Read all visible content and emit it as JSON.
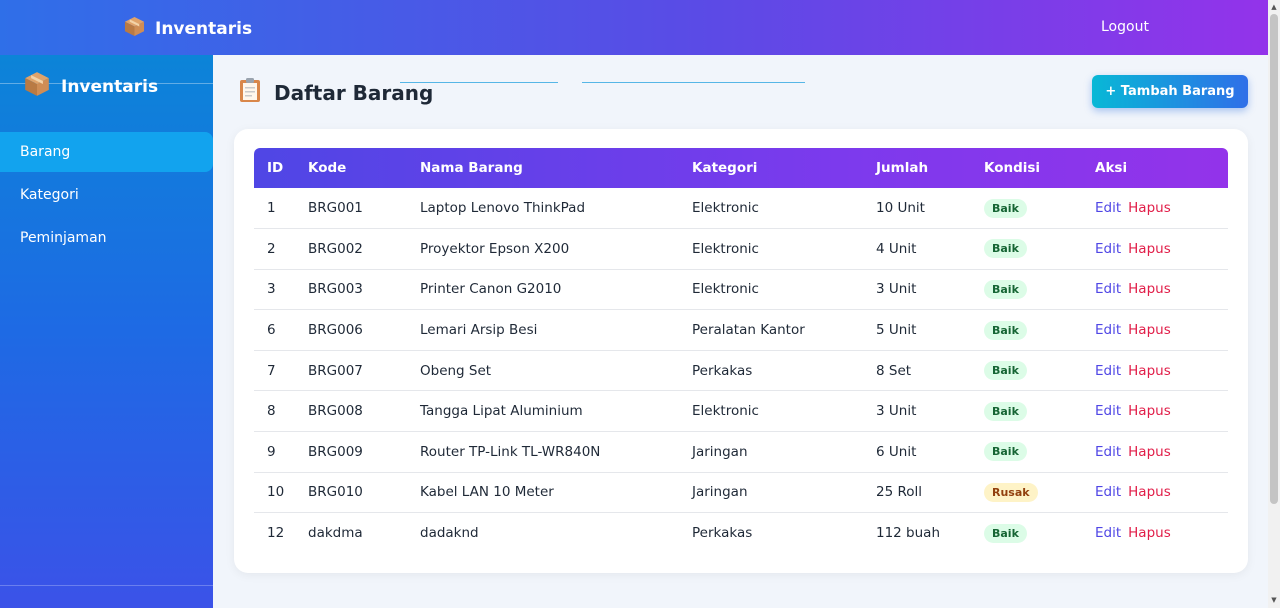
{
  "topbar": {
    "brand": "Inventaris",
    "brand_icon": "box-icon",
    "logout_label": "Logout"
  },
  "sidebar": {
    "brand": "Inventaris",
    "items": [
      {
        "label": "Barang",
        "active": true
      },
      {
        "label": "Kategori",
        "active": false
      },
      {
        "label": "Peminjaman",
        "active": false
      }
    ]
  },
  "main": {
    "title": "Daftar Barang",
    "title_icon": "clipboard-icon",
    "add_button": "+ Tambah Barang"
  },
  "table": {
    "headers": [
      "ID",
      "Kode",
      "Nama Barang",
      "Kategori",
      "Jumlah",
      "Kondisi",
      "Aksi"
    ],
    "edit_label": "Edit",
    "delete_label": "Hapus",
    "rows": [
      {
        "id": "1",
        "kode": "BRG001",
        "nama": "Laptop Lenovo ThinkPad",
        "kategori": "Elektronic",
        "jumlah": "10 Unit",
        "kondisi": "Baik"
      },
      {
        "id": "2",
        "kode": "BRG002",
        "nama": "Proyektor Epson X200",
        "kategori": "Elektronic",
        "jumlah": "4 Unit",
        "kondisi": "Baik"
      },
      {
        "id": "3",
        "kode": "BRG003",
        "nama": "Printer Canon G2010",
        "kategori": "Elektronic",
        "jumlah": "3 Unit",
        "kondisi": "Baik"
      },
      {
        "id": "6",
        "kode": "BRG006",
        "nama": "Lemari Arsip Besi",
        "kategori": "Peralatan Kantor",
        "jumlah": "5 Unit",
        "kondisi": "Baik"
      },
      {
        "id": "7",
        "kode": "BRG007",
        "nama": "Obeng Set",
        "kategori": "Perkakas",
        "jumlah": "8 Set",
        "kondisi": "Baik"
      },
      {
        "id": "8",
        "kode": "BRG008",
        "nama": "Tangga Lipat Aluminium",
        "kategori": "Elektronic",
        "jumlah": "3 Unit",
        "kondisi": "Baik"
      },
      {
        "id": "9",
        "kode": "BRG009",
        "nama": "Router TP-Link TL-WR840N",
        "kategori": "Jaringan",
        "jumlah": "6 Unit",
        "kondisi": "Baik"
      },
      {
        "id": "10",
        "kode": "BRG010",
        "nama": "Kabel LAN 10 Meter",
        "kategori": "Jaringan",
        "jumlah": "25 Roll",
        "kondisi": "Rusak"
      },
      {
        "id": "12",
        "kode": "dakdma",
        "nama": "dadaknd",
        "kategori": "Perkakas",
        "jumlah": "112 buah",
        "kondisi": "Baik"
      }
    ]
  },
  "colors": {
    "good_badge": "#dcfce7",
    "bad_badge": "#fef3c7",
    "edit_link": "#4f46e5",
    "delete_link": "#e11d48"
  }
}
